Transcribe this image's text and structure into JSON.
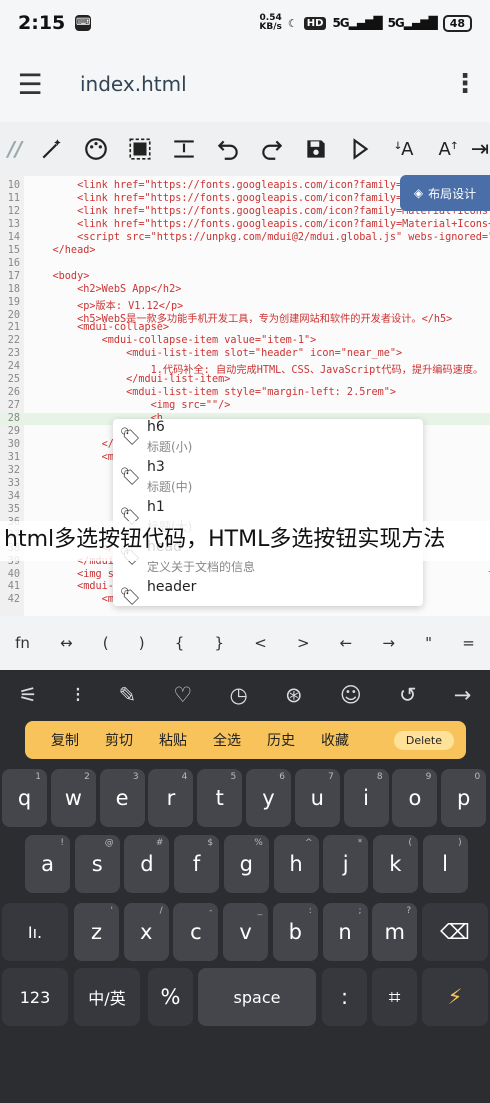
{
  "status": {
    "time": "2:15",
    "speed_top": "0.54",
    "speed_bottom": "KB/s",
    "hd": "HD",
    "sig1": "5G",
    "sig2": "5G",
    "battery": "48"
  },
  "appbar": {
    "title": "index.html"
  },
  "layout_button": "布局设计",
  "code_lines": [
    {
      "n": "10",
      "t": "        <link href=\"https://fonts.googleapis.com/icon?family=Mate"
    },
    {
      "n": "11",
      "t": "        <link href=\"https://fonts.googleapis.com/icon?family=Mate"
    },
    {
      "n": "12",
      "t": "        <link href=\"https://fonts.googleapis.com/icon?family=Material+Icons+Shar"
    },
    {
      "n": "13",
      "t": "        <link href=\"https://fonts.googleapis.com/icon?family=Material+Icons+Two+"
    },
    {
      "n": "14",
      "t": "        <script src=\"https://unpkg.com/mdui@2/mdui.global.js\" webs-ignored=\"true"
    },
    {
      "n": "15",
      "t": "    </head>"
    },
    {
      "n": "16",
      "t": ""
    },
    {
      "n": "17",
      "t": "    <body>"
    },
    {
      "n": "18",
      "t": "        <h2>WebS App</h2>"
    },
    {
      "n": "19",
      "t": "        <p>版本: V1.12</p>"
    },
    {
      "n": "20",
      "t": "        <h5>WebS是一款多功能手机开发工具，专为创建网站和软件的开发者设计。</h5>"
    },
    {
      "n": "21",
      "t": "        <mdui-collapse>"
    },
    {
      "n": "22",
      "t": "            <mdui-collapse-item value=\"item-1\">"
    },
    {
      "n": "23",
      "t": "                <mdui-list-item slot=\"header\" icon=\"near_me\">"
    },
    {
      "n": "24",
      "t": "                    1.代码补全: 自动完成HTML、CSS、JavaScript代码，提升编码速度。"
    },
    {
      "n": "25",
      "t": "                </mdui-list-item>"
    },
    {
      "n": "26",
      "t": "                <mdui-list-item style=\"margin-left: 2.5rem\">"
    },
    {
      "n": "27",
      "t": "                    <img src=\"\"/>"
    },
    {
      "n": "28",
      "t": "                    <h"
    },
    {
      "n": "29",
      "t": ""
    },
    {
      "n": "30",
      "t": "            </m"
    },
    {
      "n": "31",
      "t": "            <md"
    },
    {
      "n": "32",
      "t": ""
    },
    {
      "n": "33",
      "t": ""
    },
    {
      "n": "34",
      "t": ""
    },
    {
      "n": "35",
      "t": ""
    },
    {
      "n": "36",
      "t": ""
    },
    {
      "n": "37",
      "t": ""
    },
    {
      "n": "38",
      "t": "            </m"
    },
    {
      "n": "39",
      "t": "        </mdui-"
    },
    {
      "n": "40",
      "t": "        <img sr                                                            t=\"100%\">"
    },
    {
      "n": "41",
      "t": "        <mdui-l"
    },
    {
      "n": "42",
      "t": "            <mdui-list-item icon=\"adb\">"
    }
  ],
  "autocomplete": [
    {
      "label": "h6",
      "desc": "标题(小)"
    },
    {
      "label": "h3",
      "desc": "标题(中)"
    },
    {
      "label": "h1",
      "desc": "标题(大)"
    },
    {
      "label": "head",
      "desc": "定义关于文档的信息"
    },
    {
      "label": "header",
      "desc": ""
    }
  ],
  "overlay_title": "html多选按钮代码，HTML多选按钮实现方法",
  "symbols": [
    "fn",
    "↔",
    "(",
    ")",
    "{",
    "}",
    "<",
    ">",
    "←",
    "→",
    "\"",
    "="
  ],
  "clipboard": {
    "items": [
      "复制",
      "剪切",
      "粘贴",
      "全选",
      "历史",
      "收藏"
    ],
    "delete": "Delete"
  },
  "keys": {
    "row1": [
      {
        "k": "q",
        "h": "1"
      },
      {
        "k": "w",
        "h": "2"
      },
      {
        "k": "e",
        "h": "3"
      },
      {
        "k": "r",
        "h": "4"
      },
      {
        "k": "t",
        "h": "5"
      },
      {
        "k": "y",
        "h": "6"
      },
      {
        "k": "u",
        "h": "7"
      },
      {
        "k": "i",
        "h": "8"
      },
      {
        "k": "o",
        "h": "9"
      },
      {
        "k": "p",
        "h": "0"
      }
    ],
    "row2": [
      {
        "k": "a",
        "h": "!"
      },
      {
        "k": "s",
        "h": "@"
      },
      {
        "k": "d",
        "h": "#"
      },
      {
        "k": "f",
        "h": "$"
      },
      {
        "k": "g",
        "h": "%"
      },
      {
        "k": "h",
        "h": "^"
      },
      {
        "k": "j",
        "h": "*"
      },
      {
        "k": "k",
        "h": "("
      },
      {
        "k": "l",
        "h": ")"
      }
    ],
    "row3": [
      {
        "k": "z",
        "h": "'"
      },
      {
        "k": "x",
        "h": "/"
      },
      {
        "k": "c",
        "h": "-"
      },
      {
        "k": "v",
        "h": "_"
      },
      {
        "k": "b",
        "h": ":"
      },
      {
        "k": "n",
        "h": ";"
      },
      {
        "k": "m",
        "h": "?"
      }
    ],
    "num": "123",
    "lang": "中/英",
    "space": "space"
  }
}
